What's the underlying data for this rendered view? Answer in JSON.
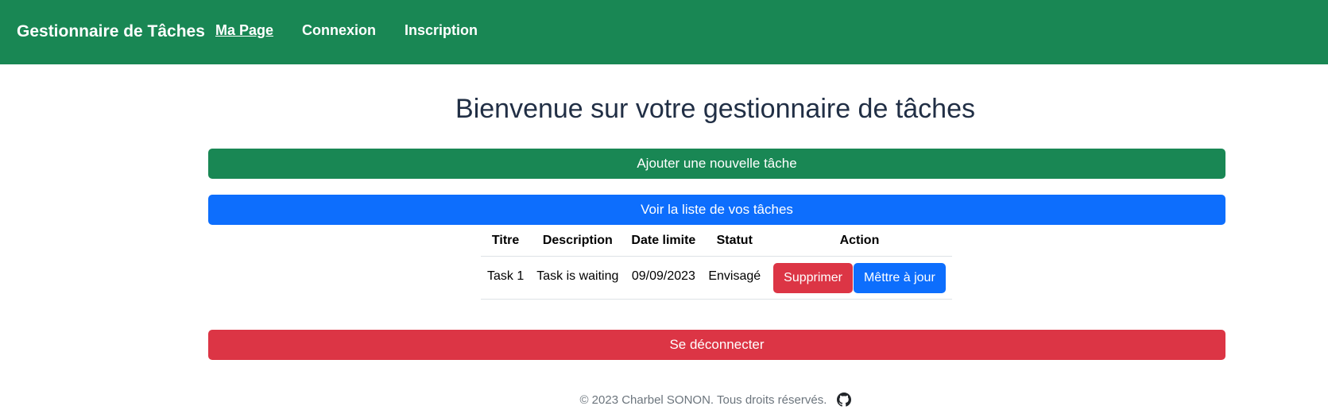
{
  "navbar": {
    "brand": "Gestionnaire de Tâches",
    "links": [
      {
        "label": "Ma Page",
        "active": true
      },
      {
        "label": "Connexion",
        "active": false
      },
      {
        "label": "Inscription",
        "active": false
      }
    ],
    "background_color": "#198754"
  },
  "main": {
    "title": "Bienvenue sur votre gestionnaire de tâches",
    "add_task_label": "Ajouter une nouvelle tâche",
    "view_list_label": "Voir la liste de vos tâches",
    "logout_label": "Se déconnecter"
  },
  "table": {
    "headers": [
      "Titre",
      "Description",
      "Date limite",
      "Statut",
      "Action"
    ],
    "rows": [
      {
        "titre": "Task 1",
        "description": "Task is waiting",
        "date_limite": "09/09/2023",
        "statut": "Envisagé",
        "delete_label": "Supprimer",
        "update_label": "Mêttre à jour"
      }
    ]
  },
  "footer": {
    "text": "© 2023 Charbel SONON. Tous droits réservés.",
    "icon": "github-icon"
  },
  "colors": {
    "success": "#198754",
    "primary": "#0d6efd",
    "danger": "#dc3545"
  }
}
